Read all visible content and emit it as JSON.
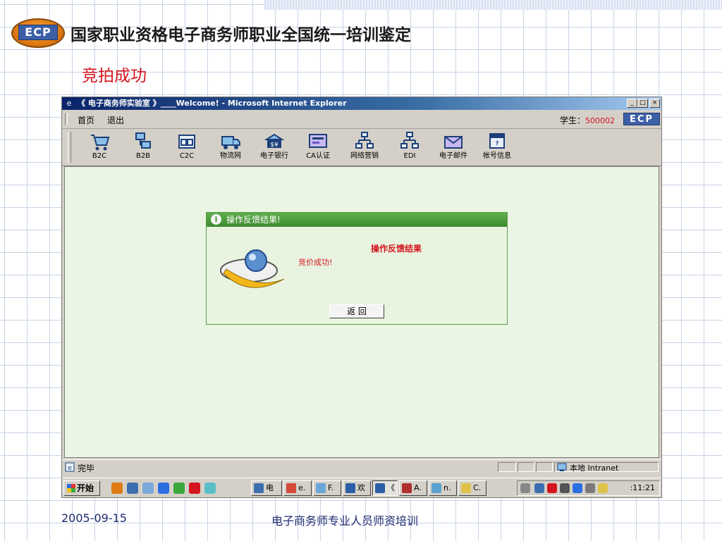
{
  "slide": {
    "logo_text": "ECP",
    "title": "国家职业资格电子商务师职业全国统一培训鉴定",
    "subtitle": "竞拍成功",
    "footer_date": "2005-09-15",
    "footer_center": "电子商务师专业人员师资培训"
  },
  "browser": {
    "title": "《 电子商务师实验室 》____Welcome! - Microsoft Internet Explorer",
    "controls": [
      "_",
      "□",
      "×"
    ],
    "menu": [
      "首页",
      "退出"
    ],
    "student_label": "学生：",
    "student_id": "500002",
    "ecp_label": "ECP",
    "toolbar": [
      {
        "label": "B2C",
        "icon": "shopping-cart-icon"
      },
      {
        "label": "B2B",
        "icon": "network-computers-icon"
      },
      {
        "label": "C2C",
        "icon": "c2c-terminal-icon"
      },
      {
        "label": "物流网",
        "icon": "truck-icon"
      },
      {
        "label": "电子银行",
        "icon": "bank-money-icon"
      },
      {
        "label": "CA认证",
        "icon": "certificate-card-icon"
      },
      {
        "label": "网络营销",
        "icon": "network-tree-icon"
      },
      {
        "label": "EDI",
        "icon": "edi-tree-icon"
      },
      {
        "label": "电子邮件",
        "icon": "email-envelope-icon"
      },
      {
        "label": "帐号信息",
        "icon": "help-calendar-icon"
      }
    ],
    "status_text": "完毕",
    "zone": "本地 Intranet"
  },
  "dialog": {
    "title": "操作反馈结果!",
    "heading": "操作反馈结果",
    "message": "竞价成功!",
    "return_label": "返 回"
  },
  "taskbar": {
    "start": "开始",
    "tasks": [
      {
        "label": "电",
        "color": "#3d6fb0"
      },
      {
        "label": "e.",
        "color": "#d64a3a"
      },
      {
        "label": "F.",
        "color": "#6aa6d8"
      },
      {
        "label": "欢",
        "color": "#2a5ea8"
      },
      {
        "label": "《",
        "color": "#2a5ea8",
        "active": true
      },
      {
        "label": "A.",
        "color": "#b03030"
      },
      {
        "label": "n.",
        "color": "#5aa0d0"
      },
      {
        "label": "C.",
        "color": "#e0c24a"
      }
    ],
    "clock": ":11:21"
  }
}
